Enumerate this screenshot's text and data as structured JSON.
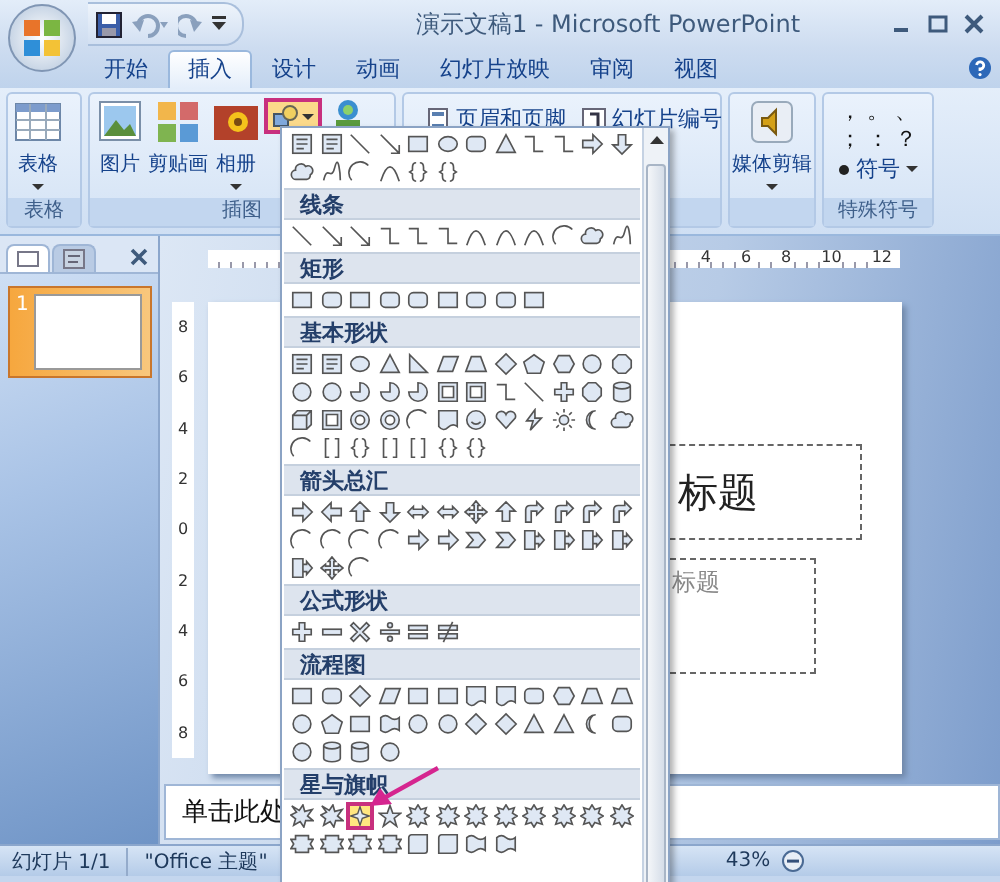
{
  "window": {
    "title": "演示文稿1 - Microsoft PowerPoint"
  },
  "tabs": [
    {
      "label": "开始",
      "selected": false
    },
    {
      "label": "插入",
      "selected": true
    },
    {
      "label": "设计",
      "selected": false
    },
    {
      "label": "动画",
      "selected": false
    },
    {
      "label": "幻灯片放映",
      "selected": false
    },
    {
      "label": "审阅",
      "selected": false
    },
    {
      "label": "视图",
      "selected": false
    }
  ],
  "ribbon": {
    "table_group": {
      "label": "表格",
      "button": "表格"
    },
    "illustrations_group": {
      "label": "插图",
      "buttons": [
        "图片",
        "剪贴画",
        "相册"
      ],
      "shapes_button": {
        "pressed": true
      }
    },
    "text_group": {
      "buttons": [
        "页眉和页脚",
        "幻灯片编号"
      ]
    },
    "media_group": {
      "button": "媒体剪辑"
    },
    "symbols_group": {
      "label": "特殊符号",
      "symbols": [
        "，",
        "。",
        "、",
        "；",
        "：",
        "？"
      ],
      "button": "符号"
    }
  },
  "shapes_menu": {
    "sections": [
      {
        "shapes": [
          {
            "kind": "textbox",
            "selected": false
          },
          {
            "kind": "textbox",
            "selected": false
          },
          {
            "kind": "line",
            "selected": false
          },
          {
            "kind": "arrowline",
            "selected": false
          },
          {
            "kind": "rect",
            "selected": false
          },
          {
            "kind": "oval",
            "selected": false
          },
          {
            "kind": "round",
            "selected": false
          },
          {
            "kind": "tri",
            "selected": false
          },
          {
            "kind": "elbow",
            "selected": false
          },
          {
            "kind": "elbow",
            "selected": false
          },
          {
            "kind": "arrowr",
            "selected": false
          },
          {
            "kind": "arrowd",
            "selected": false
          },
          {
            "kind": "cloud",
            "selected": false
          },
          {
            "kind": "scribble",
            "selected": false
          },
          {
            "kind": "arc",
            "selected": false
          },
          {
            "kind": "curve",
            "selected": false
          },
          {
            "kind": "brace",
            "selected": false
          },
          {
            "kind": "brace",
            "selected": false
          }
        ]
      },
      {
        "title": "线条",
        "shapes": [
          {
            "kind": "line",
            "selected": false
          },
          {
            "kind": "arrowline",
            "selected": false
          },
          {
            "kind": "arrowline",
            "selected": false
          },
          {
            "kind": "elbow",
            "selected": false
          },
          {
            "kind": "elbow",
            "selected": false
          },
          {
            "kind": "elbow",
            "selected": false
          },
          {
            "kind": "curve",
            "selected": false
          },
          {
            "kind": "curve",
            "selected": false
          },
          {
            "kind": "curve",
            "selected": false
          },
          {
            "kind": "arc",
            "selected": false
          },
          {
            "kind": "cloud",
            "selected": false
          },
          {
            "kind": "scribble",
            "selected": false
          }
        ]
      },
      {
        "title": "矩形",
        "shapes": [
          {
            "kind": "rect",
            "selected": false
          },
          {
            "kind": "round",
            "selected": false
          },
          {
            "kind": "rect",
            "selected": false
          },
          {
            "kind": "round",
            "selected": false
          },
          {
            "kind": "round",
            "selected": false
          },
          {
            "kind": "rect",
            "selected": false
          },
          {
            "kind": "round",
            "selected": false
          },
          {
            "kind": "round",
            "selected": false
          },
          {
            "kind": "rect",
            "selected": false
          }
        ]
      },
      {
        "title": "基本形状",
        "shapes": [
          {
            "kind": "textbox",
            "selected": false
          },
          {
            "kind": "textbox",
            "selected": false
          },
          {
            "kind": "oval",
            "selected": false
          },
          {
            "kind": "tri",
            "selected": false
          },
          {
            "kind": "rtri",
            "selected": false
          },
          {
            "kind": "para",
            "selected": false
          },
          {
            "kind": "trap",
            "selected": false
          },
          {
            "kind": "diamond",
            "selected": false
          },
          {
            "kind": "pent",
            "selected": false
          },
          {
            "kind": "hex",
            "selected": false
          },
          {
            "kind": "circle",
            "selected": false
          },
          {
            "kind": "oct",
            "selected": false
          },
          {
            "kind": "circle",
            "selected": false
          },
          {
            "kind": "circle",
            "selected": false
          },
          {
            "kind": "pie",
            "selected": false
          },
          {
            "kind": "pie",
            "selected": false
          },
          {
            "kind": "pie",
            "selected": false
          },
          {
            "kind": "frame",
            "selected": false
          },
          {
            "kind": "frame",
            "selected": false
          },
          {
            "kind": "elbow",
            "selected": false
          },
          {
            "kind": "line",
            "selected": false
          },
          {
            "kind": "plus",
            "selected": false
          },
          {
            "kind": "oct",
            "selected": false
          },
          {
            "kind": "can",
            "selected": false
          },
          {
            "kind": "cube",
            "selected": false
          },
          {
            "kind": "frame",
            "selected": false
          },
          {
            "kind": "donut",
            "selected": false
          },
          {
            "kind": "donut",
            "selected": false
          },
          {
            "kind": "arc",
            "selected": false
          },
          {
            "kind": "doc",
            "selected": false
          },
          {
            "kind": "smile",
            "selected": false
          },
          {
            "kind": "heart",
            "selected": false
          },
          {
            "kind": "bolt",
            "selected": false
          },
          {
            "kind": "sun",
            "selected": false
          },
          {
            "kind": "moon",
            "selected": false
          },
          {
            "kind": "cloud",
            "selected": false
          },
          {
            "kind": "arc",
            "selected": false
          },
          {
            "kind": "bracket",
            "selected": false
          },
          {
            "kind": "brace",
            "selected": false
          },
          {
            "kind": "bracket",
            "selected": false
          },
          {
            "kind": "bracket",
            "selected": false
          },
          {
            "kind": "brace",
            "selected": false
          },
          {
            "kind": "brace",
            "selected": false
          }
        ]
      },
      {
        "title": "箭头总汇",
        "shapes": [
          {
            "kind": "arrowr",
            "selected": false
          },
          {
            "kind": "arrowl",
            "selected": false
          },
          {
            "kind": "arrowu",
            "selected": false
          },
          {
            "kind": "arrowd",
            "selected": false
          },
          {
            "kind": "arrowlr",
            "selected": false
          },
          {
            "kind": "arrowlr",
            "selected": false
          },
          {
            "kind": "arrow4",
            "selected": false
          },
          {
            "kind": "arrowu",
            "selected": false
          },
          {
            "kind": "bent",
            "selected": false
          },
          {
            "kind": "bent",
            "selected": false
          },
          {
            "kind": "bent",
            "selected": false
          },
          {
            "kind": "bent",
            "selected": false
          },
          {
            "kind": "arc",
            "selected": false
          },
          {
            "kind": "arc",
            "selected": false
          },
          {
            "kind": "arc",
            "selected": false
          },
          {
            "kind": "arc",
            "selected": false
          },
          {
            "kind": "arrowr",
            "selected": false
          },
          {
            "kind": "arrowr",
            "selected": false
          },
          {
            "kind": "chevron",
            "selected": false
          },
          {
            "kind": "chevron",
            "selected": false
          },
          {
            "kind": "callout",
            "selected": false
          },
          {
            "kind": "callout",
            "selected": false
          },
          {
            "kind": "callout",
            "selected": false
          },
          {
            "kind": "callout",
            "selected": false
          },
          {
            "kind": "callout",
            "selected": false
          },
          {
            "kind": "arrow4",
            "selected": false
          },
          {
            "kind": "arc",
            "selected": false
          }
        ]
      },
      {
        "title": "公式形状",
        "shapes": [
          {
            "kind": "plus",
            "selected": false
          },
          {
            "kind": "minus",
            "selected": false
          },
          {
            "kind": "times",
            "selected": false
          },
          {
            "kind": "divide",
            "selected": false
          },
          {
            "kind": "equal",
            "selected": false
          },
          {
            "kind": "notequal",
            "selected": false
          }
        ]
      },
      {
        "title": "流程图",
        "shapes": [
          {
            "kind": "rect",
            "selected": false
          },
          {
            "kind": "round",
            "selected": false
          },
          {
            "kind": "diamond",
            "selected": false
          },
          {
            "kind": "para",
            "selected": false
          },
          {
            "kind": "rect",
            "selected": false
          },
          {
            "kind": "rect",
            "selected": false
          },
          {
            "kind": "doc",
            "selected": false
          },
          {
            "kind": "doc",
            "selected": false
          },
          {
            "kind": "round",
            "selected": false
          },
          {
            "kind": "hex",
            "selected": false
          },
          {
            "kind": "trap",
            "selected": false
          },
          {
            "kind": "trap",
            "selected": false
          },
          {
            "kind": "circle",
            "selected": false
          },
          {
            "kind": "pent",
            "selected": false
          },
          {
            "kind": "rect",
            "selected": false
          },
          {
            "kind": "wave",
            "selected": false
          },
          {
            "kind": "circle",
            "selected": false
          },
          {
            "kind": "circle",
            "selected": false
          },
          {
            "kind": "diamond",
            "selected": false
          },
          {
            "kind": "diamond",
            "selected": false
          },
          {
            "kind": "tri",
            "selected": false
          },
          {
            "kind": "tri",
            "selected": false
          },
          {
            "kind": "moon",
            "selected": false
          },
          {
            "kind": "round",
            "selected": false
          },
          {
            "kind": "circle",
            "selected": false
          },
          {
            "kind": "can",
            "selected": false
          },
          {
            "kind": "can",
            "selected": false
          },
          {
            "kind": "circle",
            "selected": false
          }
        ]
      },
      {
        "title": "星与旗帜",
        "shapes": [
          {
            "kind": "burst",
            "selected": false
          },
          {
            "kind": "burst",
            "selected": false
          },
          {
            "kind": "star4",
            "selected": true
          },
          {
            "kind": "star5",
            "selected": false
          },
          {
            "kind": "starn",
            "selected": false
          },
          {
            "kind": "starn",
            "selected": false
          },
          {
            "kind": "starn",
            "selected": false
          },
          {
            "kind": "starn",
            "selected": false
          },
          {
            "kind": "starn",
            "selected": false
          },
          {
            "kind": "starn",
            "selected": false
          },
          {
            "kind": "starn",
            "selected": false
          },
          {
            "kind": "starn",
            "selected": false
          },
          {
            "kind": "ribbon",
            "selected": false
          },
          {
            "kind": "ribbon",
            "selected": false
          },
          {
            "kind": "ribbon",
            "selected": false
          },
          {
            "kind": "ribbon",
            "selected": false
          },
          {
            "kind": "scroll",
            "selected": false
          },
          {
            "kind": "scroll",
            "selected": false
          },
          {
            "kind": "wave",
            "selected": false
          },
          {
            "kind": "wave",
            "selected": false
          }
        ]
      }
    ]
  },
  "slides_panel": {
    "tabs": [
      {
        "kind": "slides",
        "selected": true
      },
      {
        "kind": "outline",
        "selected": false
      }
    ],
    "slides": [
      {
        "number": "1",
        "selected": true
      }
    ]
  },
  "horizontal_ruler": [
    "4",
    "6",
    "8",
    "10",
    "12"
  ],
  "vertical_ruler": [
    "8",
    "6",
    "4",
    "2",
    "0",
    "2",
    "4",
    "6",
    "8"
  ],
  "slide": {
    "title_placeholder": "标题",
    "subtitle_placeholder": "标题"
  },
  "notes": {
    "placeholder": "单击此处"
  },
  "status_bar": {
    "slide": "幻灯片 1/1",
    "theme": "\"Office 主题\"",
    "zoom": "43%"
  }
}
